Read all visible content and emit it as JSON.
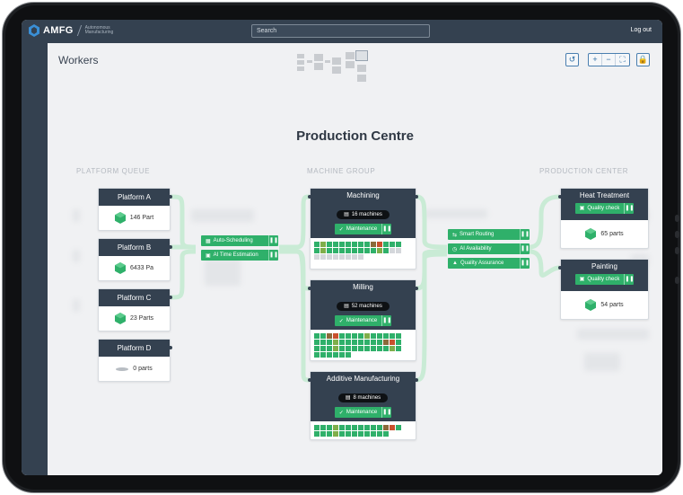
{
  "app": {
    "brand": "AMFG",
    "brand_sub": "Autonomous Manufacturing",
    "search_placeholder": "Search",
    "logout": "Log out"
  },
  "page": {
    "section": "Workers",
    "title": "Production Centre"
  },
  "columns": {
    "left": "PLATFORM QUEUE",
    "middle": "MACHINE GROUP",
    "right": "PRODUCTION CENTER"
  },
  "platforms": [
    {
      "name": "Platform A",
      "parts": "146 Part"
    },
    {
      "name": "Platform B",
      "parts": "6433 Pa"
    },
    {
      "name": "Platform C",
      "parts": "23 Parts"
    },
    {
      "name": "Platform D",
      "parts": "0 parts"
    }
  ],
  "queue_actions": [
    {
      "label": "Auto-Scheduling",
      "icon": "calendar-icon"
    },
    {
      "label": "AI Time Estimation",
      "icon": "robot-icon"
    }
  ],
  "machine_groups": [
    {
      "name": "Machining",
      "machines": "16 machines",
      "action": "Maintenance"
    },
    {
      "name": "Milling",
      "machines": "52 machines",
      "action": "Maintenance"
    },
    {
      "name": "Additive Manufacturing",
      "machines": "8 machines",
      "action": "Maintenance"
    }
  ],
  "routing_actions": [
    {
      "label": "Smart Routing",
      "icon": "routing-icon"
    },
    {
      "label": "AI Availability",
      "icon": "clock-icon"
    },
    {
      "label": "Quality Assurance",
      "icon": "shield-icon"
    }
  ],
  "production_centers": [
    {
      "name": "Heat Treatment",
      "action": "Quality check",
      "parts": "65 parts"
    },
    {
      "name": "Painting",
      "action": "Quality check",
      "parts": "54 parts"
    }
  ],
  "colors": {
    "dark": "#344150",
    "green": "#2fb06a",
    "connector": "#c9ebd5"
  }
}
